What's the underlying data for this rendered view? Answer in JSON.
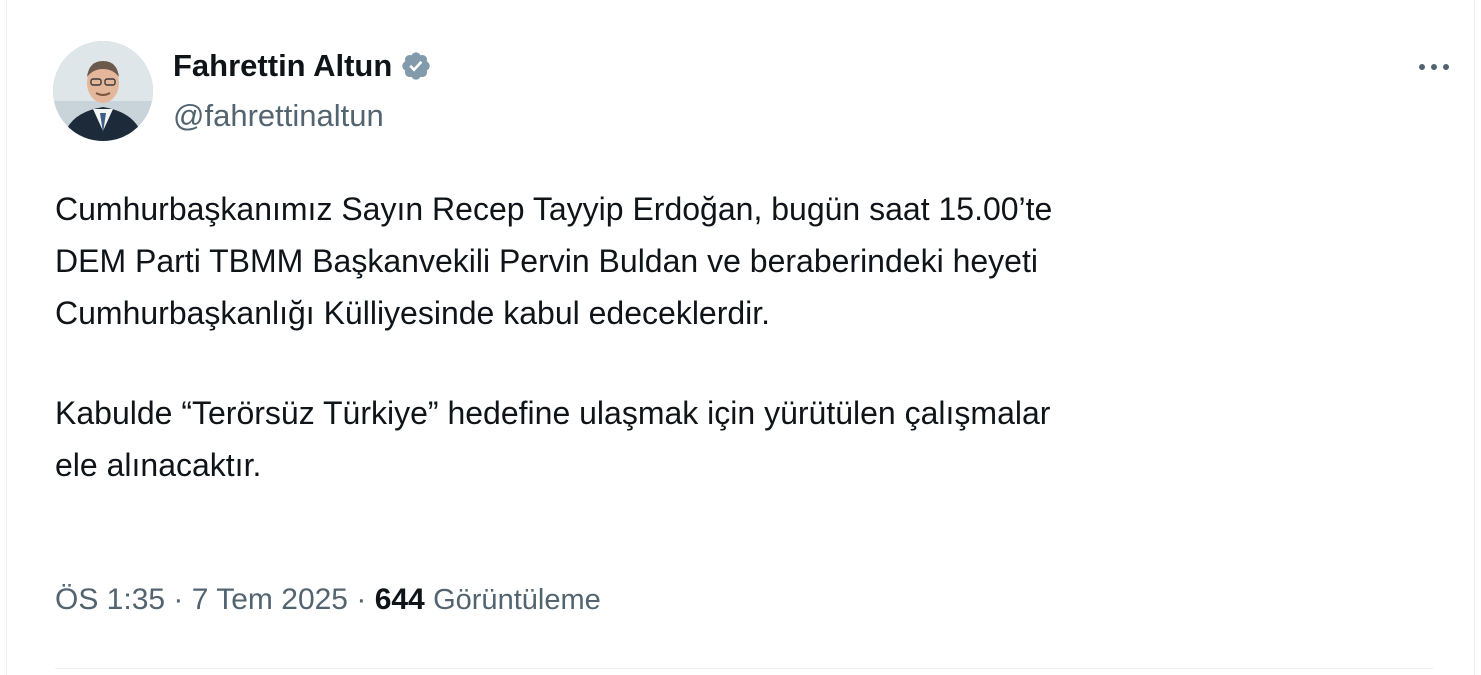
{
  "author": {
    "name": "Fahrettin Altun",
    "handle": "@fahrettinaltun",
    "verified_color": "#829aab"
  },
  "more_icon": "more-horizontal-icon",
  "tweet": {
    "paragraphs": [
      [
        "Cumhurbaşkanımız Sayın Recep Tayyip Erdoğan, bugün saat 15.00’te",
        "DEM Parti TBMM Başkanvekili Pervin Buldan ve beraberindeki heyeti",
        "Cumhurbaşkanlığı Külliyesinde kabul edeceklerdir."
      ],
      [
        "Kabulde “Terörsüz Türkiye” hedefine ulaşmak için yürütülen çalışmalar",
        "ele alınacaktır."
      ]
    ]
  },
  "meta": {
    "time": "ÖS 1:35",
    "separator": "·",
    "date": "7 Tem 2025",
    "views_count": "644",
    "views_label": "Görüntüleme"
  }
}
